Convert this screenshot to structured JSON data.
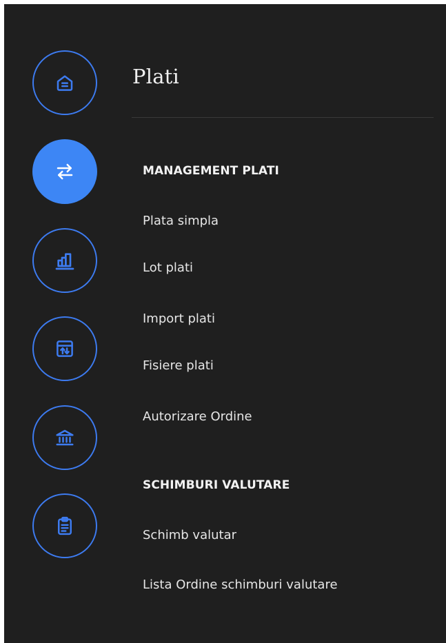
{
  "panel": {
    "title": "Plati"
  },
  "rail": {
    "items": [
      {
        "icon": "home-icon",
        "active": false
      },
      {
        "icon": "transfer-arrows-icon",
        "active": true
      },
      {
        "icon": "bar-chart-icon",
        "active": false
      },
      {
        "icon": "calendar-transfer-icon",
        "active": false
      },
      {
        "icon": "bank-icon",
        "active": false
      },
      {
        "icon": "clipboard-icon",
        "active": false
      }
    ]
  },
  "sections": [
    {
      "heading": "MANAGEMENT PLATI",
      "items": [
        "Plata simpla",
        "Lot plati",
        "Import plati",
        "Fisiere plati",
        "Autorizare Ordine"
      ]
    },
    {
      "heading": "SCHIMBURI VALUTARE",
      "items": [
        "Schimb valutar",
        "Lista Ordine schimburi valutare"
      ]
    }
  ],
  "colors": {
    "background": "#1f1f1f",
    "accent": "#3d7bf0",
    "active_fill": "#3d86f5"
  }
}
